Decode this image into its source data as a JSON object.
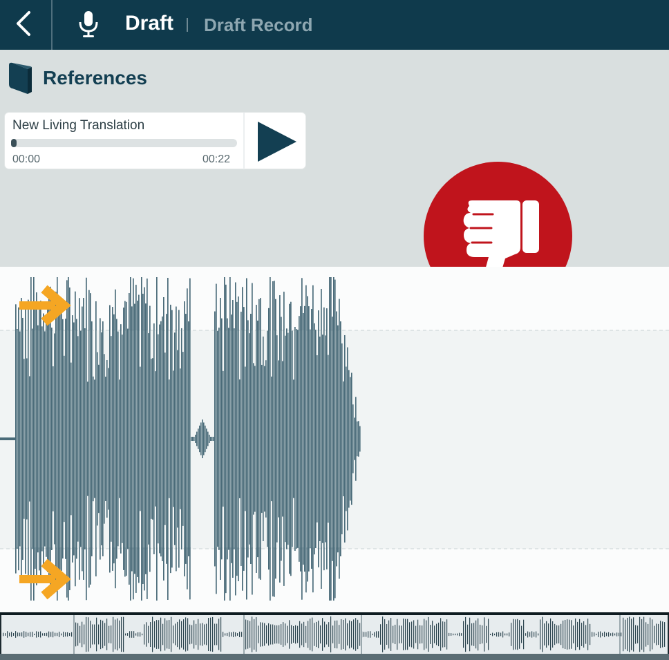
{
  "header": {
    "title": "Draft",
    "subtitle": "Draft Record",
    "back_icon": "chevron-left-icon",
    "mic_icon": "microphone-icon"
  },
  "references": {
    "title": "References",
    "icon": "book-icon",
    "player": {
      "name": "New Living Translation",
      "time_start": "00:00",
      "time_end": "00:22",
      "progress": 0.0
    }
  },
  "overlay": {
    "icon": "thumbs-down-icon",
    "color": "#c0141c",
    "arrow_icon": "arrow-right-icon",
    "arrow_color": "#f5a623"
  },
  "colors": {
    "header_bg": "#0f3a4c",
    "wave_dark": "#12455a",
    "wave_mid": "#4a6b79",
    "panel_bg": "#d9dfdf"
  }
}
